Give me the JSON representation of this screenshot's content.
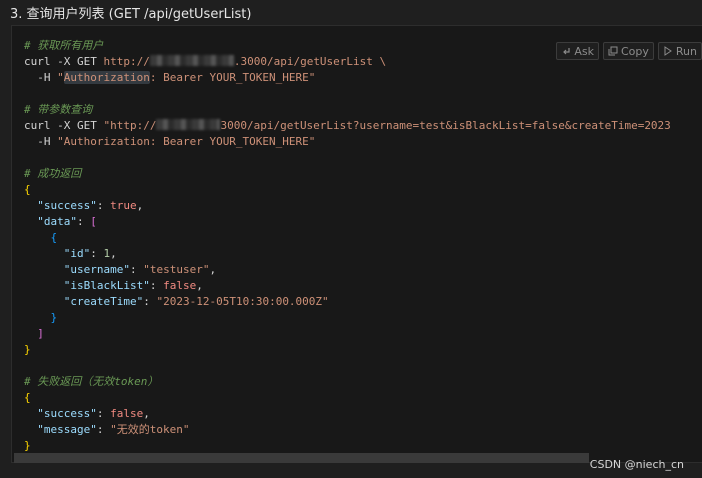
{
  "heading": "3. 查询用户列表 (GET /api/getUserList)",
  "toolbar": {
    "ask": "Ask",
    "copy": "Copy",
    "run": "Run"
  },
  "code": {
    "comment_get_all": "# 获取所有用户",
    "curl_cmd": "curl -X GET ",
    "http_prefix": "http://",
    "url_tail_1": ".3000/api/getUserList \\",
    "header_indent": "  -H ",
    "quote": "\"",
    "auth_word": "Authorization",
    "header_rest_1": ": Bearer YOUR_TOKEN_HERE\"",
    "comment_params": "# 带参数查询",
    "url_tail_2": "3000/api/getUserList?username=test&isBlackList=false&createTime=2023",
    "header_full": "\"Authorization: Bearer YOUR_TOKEN_HERE\"",
    "comment_success": "# 成功返回",
    "comment_fail": "# 失败返回（无效token）",
    "k_success": "\"success\"",
    "k_data": "\"data\"",
    "k_id": "\"id\"",
    "k_username": "\"username\"",
    "k_isBlackList": "\"isBlackList\"",
    "k_createTime": "\"createTime\"",
    "k_message": "\"message\"",
    "v_true": "true",
    "v_false": "false",
    "v_id": "1",
    "v_username": "\"testuser\"",
    "v_createTime": "\"2023-12-05T10:30:00.000Z\"",
    "v_message": "\"无效的token\""
  },
  "watermark": "CSDN @niech_cn"
}
